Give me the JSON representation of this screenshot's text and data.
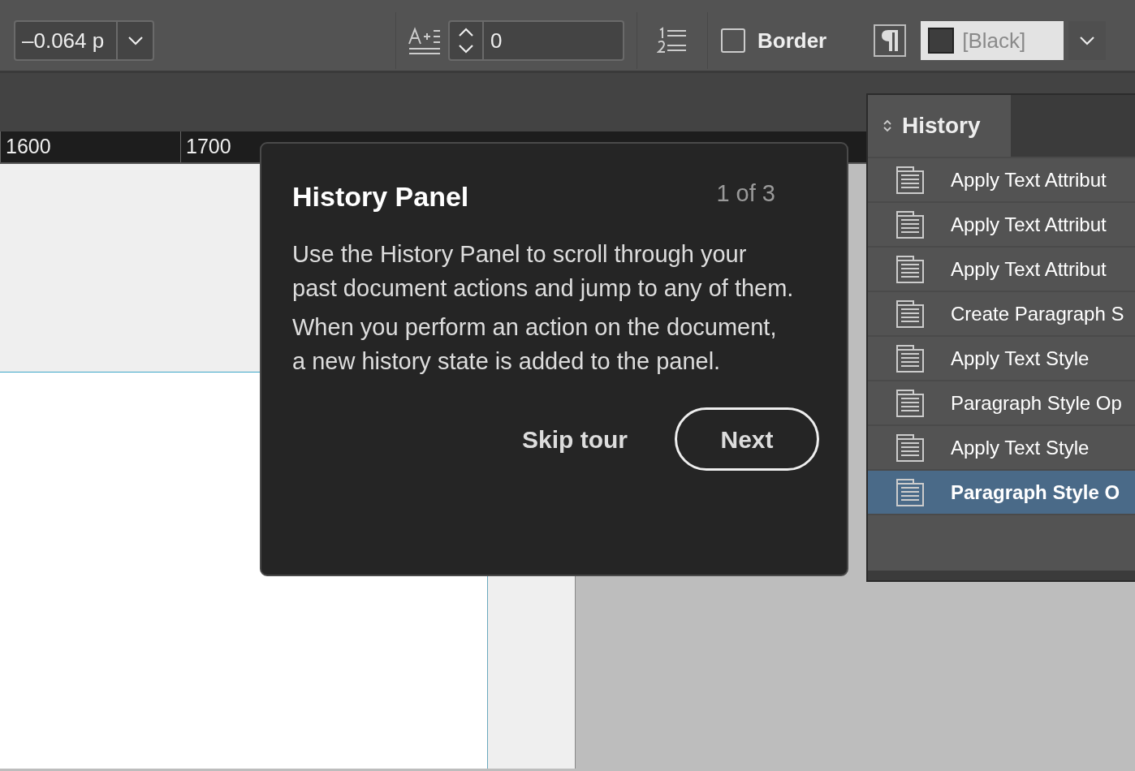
{
  "toolbar": {
    "tracking_field": {
      "value": "–0.064 p"
    },
    "space_field": {
      "value": "0"
    },
    "border_checkbox": {
      "label": "Border",
      "checked": false
    },
    "color_field": {
      "value": "[Black]"
    }
  },
  "ruler": {
    "labels": [
      "1600",
      "1700"
    ]
  },
  "tour": {
    "title": "History Panel",
    "counter": "1 of 3",
    "paragraphs": [
      "Use the History Panel to scroll through your past document actions and jump to any of them.",
      "When you perform an action on the document, a new history state is added to the panel."
    ],
    "buttons": [
      {
        "label": "Skip tour",
        "kind": "text"
      },
      {
        "label": "Next",
        "kind": "outline"
      }
    ]
  },
  "history_panel": {
    "tab": "History",
    "items": [
      {
        "label": "Apply Text Attribut",
        "selected": false
      },
      {
        "label": "Apply Text Attribut",
        "selected": false
      },
      {
        "label": "Apply Text Attribut",
        "selected": false
      },
      {
        "label": "Create Paragraph S",
        "selected": false
      },
      {
        "label": "Apply Text Style",
        "selected": false
      },
      {
        "label": "Paragraph Style Op",
        "selected": false
      },
      {
        "label": "Apply Text Style",
        "selected": false
      },
      {
        "label": "Paragraph Style O",
        "selected": true
      }
    ]
  }
}
